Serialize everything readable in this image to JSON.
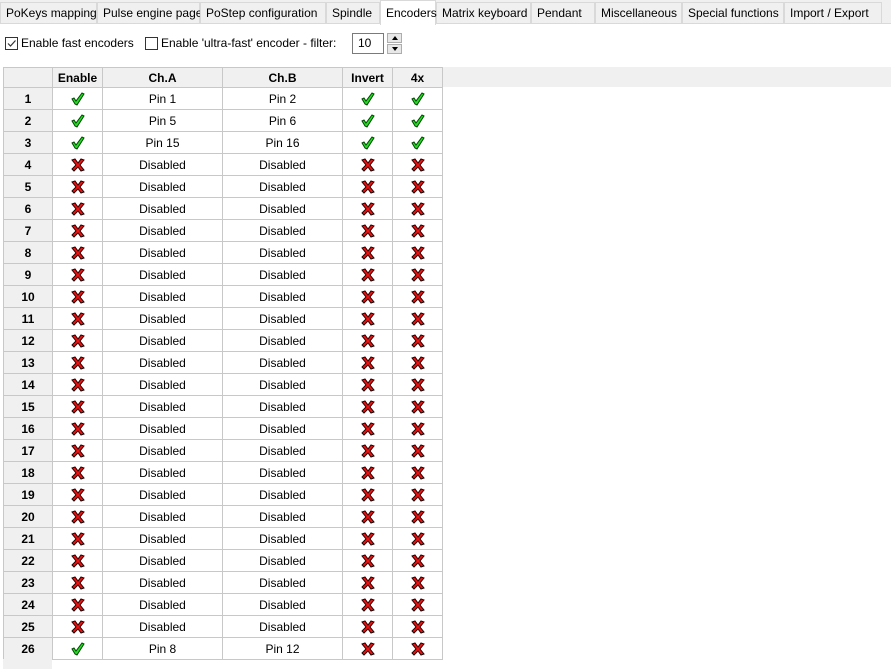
{
  "tabs": [
    {
      "label": "PoKeys mapping",
      "active": false
    },
    {
      "label": "Pulse engine page",
      "active": false
    },
    {
      "label": "PoStep configuration",
      "active": false
    },
    {
      "label": "Spindle",
      "active": false
    },
    {
      "label": "Encoders",
      "active": true
    },
    {
      "label": "Matrix keyboard",
      "active": false
    },
    {
      "label": "Pendant",
      "active": false
    },
    {
      "label": "Miscellaneous",
      "active": false
    },
    {
      "label": "Special functions",
      "active": false
    },
    {
      "label": "Import / Export",
      "active": false
    }
  ],
  "options": {
    "fast_encoders": {
      "label": "Enable fast encoders",
      "checked": true
    },
    "ultra_fast": {
      "label": "Enable 'ultra-fast' encoder - filter:",
      "checked": false
    },
    "filter_value": "10"
  },
  "grid": {
    "columns": [
      "Enable",
      "Ch.A",
      "Ch.B",
      "Invert",
      "4x"
    ],
    "icons": {
      "true": "green-check-icon",
      "false": "red-x-icon"
    },
    "rows": [
      {
        "num": "1",
        "enable": true,
        "cha": "Pin 1",
        "chb": "Pin 2",
        "invert": true,
        "x4": true
      },
      {
        "num": "2",
        "enable": true,
        "cha": "Pin 5",
        "chb": "Pin 6",
        "invert": true,
        "x4": true
      },
      {
        "num": "3",
        "enable": true,
        "cha": "Pin 15",
        "chb": "Pin 16",
        "invert": true,
        "x4": true
      },
      {
        "num": "4",
        "enable": false,
        "cha": "Disabled",
        "chb": "Disabled",
        "invert": false,
        "x4": false
      },
      {
        "num": "5",
        "enable": false,
        "cha": "Disabled",
        "chb": "Disabled",
        "invert": false,
        "x4": false
      },
      {
        "num": "6",
        "enable": false,
        "cha": "Disabled",
        "chb": "Disabled",
        "invert": false,
        "x4": false
      },
      {
        "num": "7",
        "enable": false,
        "cha": "Disabled",
        "chb": "Disabled",
        "invert": false,
        "x4": false
      },
      {
        "num": "8",
        "enable": false,
        "cha": "Disabled",
        "chb": "Disabled",
        "invert": false,
        "x4": false
      },
      {
        "num": "9",
        "enable": false,
        "cha": "Disabled",
        "chb": "Disabled",
        "invert": false,
        "x4": false
      },
      {
        "num": "10",
        "enable": false,
        "cha": "Disabled",
        "chb": "Disabled",
        "invert": false,
        "x4": false
      },
      {
        "num": "11",
        "enable": false,
        "cha": "Disabled",
        "chb": "Disabled",
        "invert": false,
        "x4": false
      },
      {
        "num": "12",
        "enable": false,
        "cha": "Disabled",
        "chb": "Disabled",
        "invert": false,
        "x4": false
      },
      {
        "num": "13",
        "enable": false,
        "cha": "Disabled",
        "chb": "Disabled",
        "invert": false,
        "x4": false
      },
      {
        "num": "14",
        "enable": false,
        "cha": "Disabled",
        "chb": "Disabled",
        "invert": false,
        "x4": false
      },
      {
        "num": "15",
        "enable": false,
        "cha": "Disabled",
        "chb": "Disabled",
        "invert": false,
        "x4": false
      },
      {
        "num": "16",
        "enable": false,
        "cha": "Disabled",
        "chb": "Disabled",
        "invert": false,
        "x4": false
      },
      {
        "num": "17",
        "enable": false,
        "cha": "Disabled",
        "chb": "Disabled",
        "invert": false,
        "x4": false
      },
      {
        "num": "18",
        "enable": false,
        "cha": "Disabled",
        "chb": "Disabled",
        "invert": false,
        "x4": false
      },
      {
        "num": "19",
        "enable": false,
        "cha": "Disabled",
        "chb": "Disabled",
        "invert": false,
        "x4": false
      },
      {
        "num": "20",
        "enable": false,
        "cha": "Disabled",
        "chb": "Disabled",
        "invert": false,
        "x4": false
      },
      {
        "num": "21",
        "enable": false,
        "cha": "Disabled",
        "chb": "Disabled",
        "invert": false,
        "x4": false
      },
      {
        "num": "22",
        "enable": false,
        "cha": "Disabled",
        "chb": "Disabled",
        "invert": false,
        "x4": false
      },
      {
        "num": "23",
        "enable": false,
        "cha": "Disabled",
        "chb": "Disabled",
        "invert": false,
        "x4": false
      },
      {
        "num": "24",
        "enable": false,
        "cha": "Disabled",
        "chb": "Disabled",
        "invert": false,
        "x4": false
      },
      {
        "num": "25",
        "enable": false,
        "cha": "Disabled",
        "chb": "Disabled",
        "invert": false,
        "x4": false
      },
      {
        "num": "26",
        "enable": true,
        "cha": "Pin 8",
        "chb": "Pin 12",
        "invert": false,
        "x4": false
      }
    ]
  },
  "colors": {
    "check_green": "#22dd22",
    "x_red": "#ee1111",
    "header_bg": "#f0f0f0",
    "grid_line": "#c8c8c8"
  }
}
